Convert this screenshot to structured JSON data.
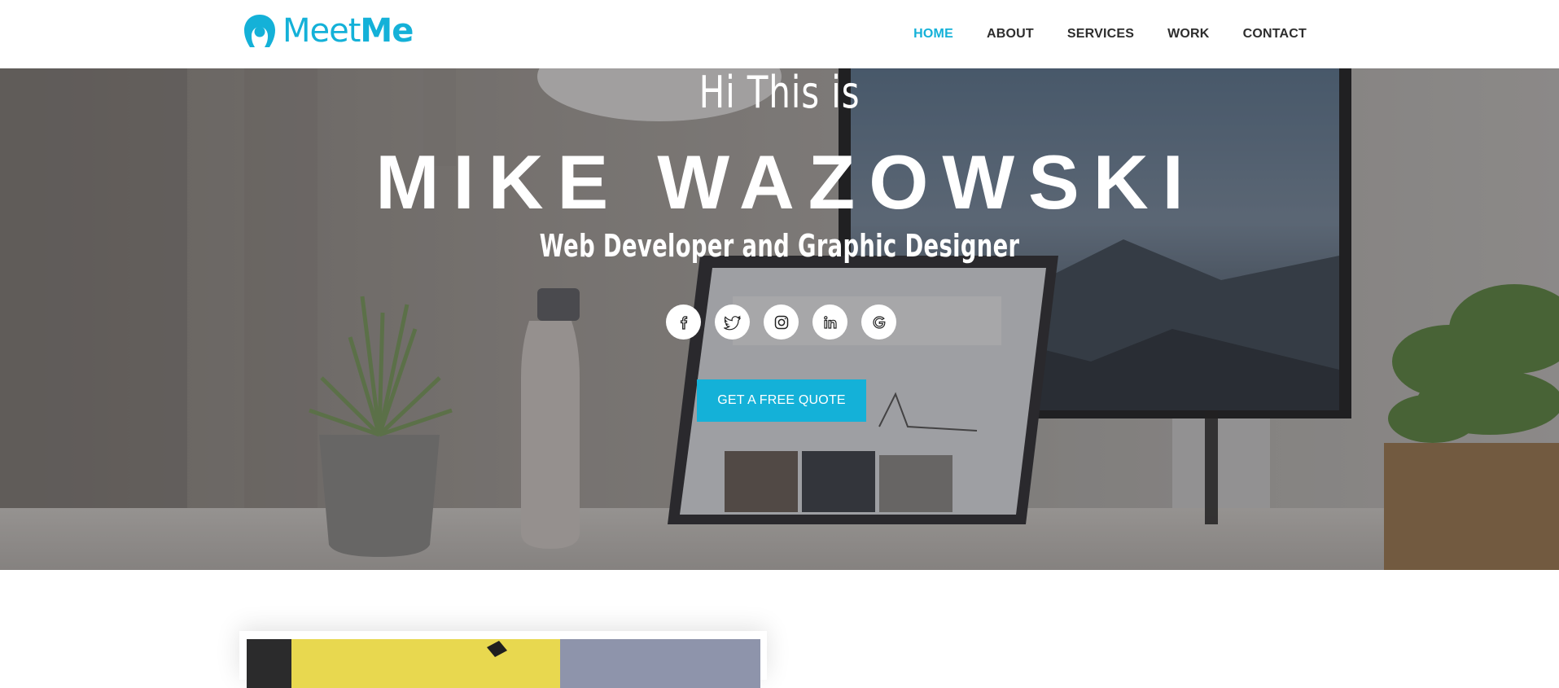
{
  "header": {
    "logo": {
      "text_light": "Meet",
      "text_bold": "Me",
      "icon": "person-avatar-icon",
      "color": "#14b1d8"
    },
    "nav": [
      {
        "label": "HOME",
        "active": true
      },
      {
        "label": "ABOUT",
        "active": false
      },
      {
        "label": "SERVICES",
        "active": false
      },
      {
        "label": "WORK",
        "active": false
      },
      {
        "label": "CONTACT",
        "active": false
      }
    ]
  },
  "hero": {
    "greeting": "Hi This is",
    "name": "MIKE WAZOWSKI",
    "role": "Web Developer and Graphic Designer",
    "socials": [
      {
        "icon": "facebook-icon"
      },
      {
        "icon": "twitter-icon"
      },
      {
        "icon": "instagram-icon"
      },
      {
        "icon": "linkedin-icon"
      },
      {
        "icon": "google-icon"
      }
    ],
    "cta_label": "GET A FREE QUOTE"
  },
  "colors": {
    "accent": "#14b1d8",
    "nav_text": "#2d2d2d"
  }
}
